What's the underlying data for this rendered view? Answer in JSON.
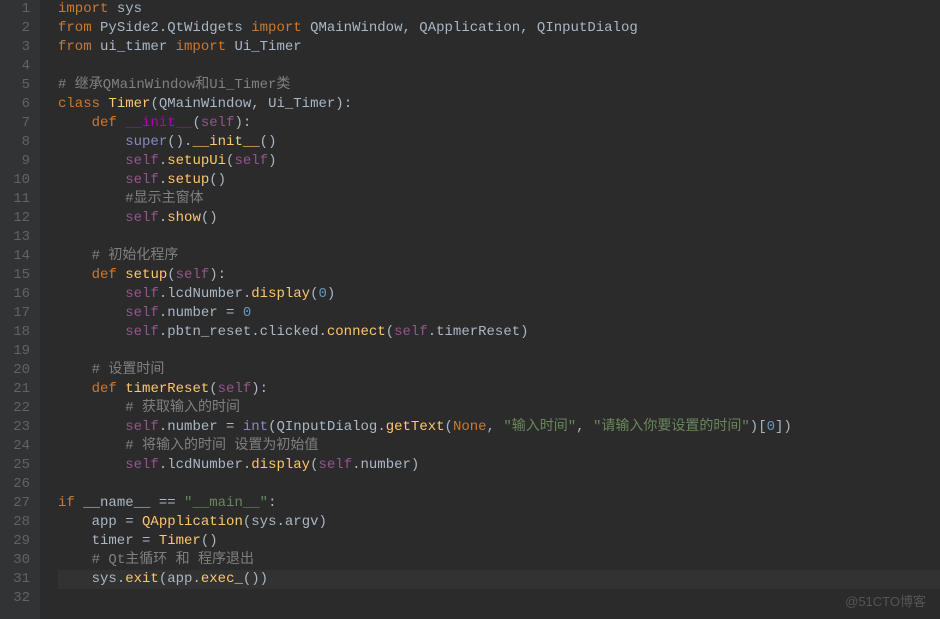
{
  "watermark": "@51CTO博客",
  "lines": [
    {
      "n": 1,
      "tokens": [
        [
          "keyword",
          "import"
        ],
        [
          "ident",
          " sys"
        ]
      ]
    },
    {
      "n": 2,
      "tokens": [
        [
          "keyword",
          "from"
        ],
        [
          "ident",
          " PySide2.QtWidgets "
        ],
        [
          "keyword",
          "import"
        ],
        [
          "ident",
          " QMainWindow"
        ],
        [
          "op",
          ","
        ],
        [
          "ident",
          " QApplication"
        ],
        [
          "op",
          ","
        ],
        [
          "ident",
          " QInputDialog"
        ]
      ]
    },
    {
      "n": 3,
      "tokens": [
        [
          "keyword",
          "from"
        ],
        [
          "ident",
          " ui_timer "
        ],
        [
          "keyword",
          "import"
        ],
        [
          "ident",
          " Ui_Timer"
        ]
      ]
    },
    {
      "n": 4,
      "tokens": []
    },
    {
      "n": 5,
      "tokens": [
        [
          "comment",
          "# 继承QMainWindow和Ui_Timer类"
        ]
      ]
    },
    {
      "n": 6,
      "tokens": [
        [
          "keyword",
          "class"
        ],
        [
          "ident",
          " "
        ],
        [
          "defname",
          "Timer"
        ],
        [
          "paren",
          "("
        ],
        [
          "ident",
          "QMainWindow"
        ],
        [
          "op",
          ","
        ],
        [
          "ident",
          " Ui_Timer"
        ],
        [
          "paren",
          ")"
        ],
        [
          "op",
          ":"
        ]
      ]
    },
    {
      "n": 7,
      "tokens": [
        [
          "ident",
          "    "
        ],
        [
          "keyword",
          "def"
        ],
        [
          "ident",
          " "
        ],
        [
          "special",
          "__init__"
        ],
        [
          "paren",
          "("
        ],
        [
          "self",
          "self"
        ],
        [
          "paren",
          ")"
        ],
        [
          "op",
          ":"
        ]
      ]
    },
    {
      "n": 8,
      "tokens": [
        [
          "ident",
          "        "
        ],
        [
          "builtin",
          "super"
        ],
        [
          "paren",
          "()"
        ],
        [
          "op",
          "."
        ],
        [
          "func",
          "__init__"
        ],
        [
          "paren",
          "()"
        ]
      ]
    },
    {
      "n": 9,
      "tokens": [
        [
          "ident",
          "        "
        ],
        [
          "self",
          "self"
        ],
        [
          "op",
          "."
        ],
        [
          "func",
          "setupUi"
        ],
        [
          "paren",
          "("
        ],
        [
          "self",
          "self"
        ],
        [
          "paren",
          ")"
        ]
      ]
    },
    {
      "n": 10,
      "tokens": [
        [
          "ident",
          "        "
        ],
        [
          "self",
          "self"
        ],
        [
          "op",
          "."
        ],
        [
          "func",
          "setup"
        ],
        [
          "paren",
          "()"
        ]
      ]
    },
    {
      "n": 11,
      "tokens": [
        [
          "ident",
          "        "
        ],
        [
          "comment",
          "#显示主窗体"
        ]
      ]
    },
    {
      "n": 12,
      "tokens": [
        [
          "ident",
          "        "
        ],
        [
          "self",
          "self"
        ],
        [
          "op",
          "."
        ],
        [
          "func",
          "show"
        ],
        [
          "paren",
          "()"
        ]
      ]
    },
    {
      "n": 13,
      "tokens": []
    },
    {
      "n": 14,
      "tokens": [
        [
          "ident",
          "    "
        ],
        [
          "comment",
          "# 初始化程序"
        ]
      ]
    },
    {
      "n": 15,
      "tokens": [
        [
          "ident",
          "    "
        ],
        [
          "keyword",
          "def"
        ],
        [
          "ident",
          " "
        ],
        [
          "defname",
          "setup"
        ],
        [
          "paren",
          "("
        ],
        [
          "self",
          "self"
        ],
        [
          "paren",
          ")"
        ],
        [
          "op",
          ":"
        ]
      ]
    },
    {
      "n": 16,
      "tokens": [
        [
          "ident",
          "        "
        ],
        [
          "self",
          "self"
        ],
        [
          "op",
          "."
        ],
        [
          "ident",
          "lcdNumber"
        ],
        [
          "op",
          "."
        ],
        [
          "func",
          "display"
        ],
        [
          "paren",
          "("
        ],
        [
          "number",
          "0"
        ],
        [
          "paren",
          ")"
        ]
      ]
    },
    {
      "n": 17,
      "tokens": [
        [
          "ident",
          "        "
        ],
        [
          "self",
          "self"
        ],
        [
          "op",
          "."
        ],
        [
          "ident",
          "number "
        ],
        [
          "op",
          "="
        ],
        [
          "ident",
          " "
        ],
        [
          "number",
          "0"
        ]
      ]
    },
    {
      "n": 18,
      "tokens": [
        [
          "ident",
          "        "
        ],
        [
          "self",
          "self"
        ],
        [
          "op",
          "."
        ],
        [
          "ident",
          "pbtn_reset"
        ],
        [
          "op",
          "."
        ],
        [
          "ident",
          "clicked"
        ],
        [
          "op",
          "."
        ],
        [
          "func",
          "connect"
        ],
        [
          "paren",
          "("
        ],
        [
          "self",
          "self"
        ],
        [
          "op",
          "."
        ],
        [
          "ident",
          "timerReset"
        ],
        [
          "paren",
          ")"
        ]
      ]
    },
    {
      "n": 19,
      "tokens": []
    },
    {
      "n": 20,
      "tokens": [
        [
          "ident",
          "    "
        ],
        [
          "comment",
          "# 设置时间"
        ]
      ]
    },
    {
      "n": 21,
      "tokens": [
        [
          "ident",
          "    "
        ],
        [
          "keyword",
          "def"
        ],
        [
          "ident",
          " "
        ],
        [
          "defname",
          "timerReset"
        ],
        [
          "paren",
          "("
        ],
        [
          "self",
          "self"
        ],
        [
          "paren",
          ")"
        ],
        [
          "op",
          ":"
        ]
      ]
    },
    {
      "n": 22,
      "tokens": [
        [
          "ident",
          "        "
        ],
        [
          "comment",
          "# 获取输入的时间"
        ]
      ]
    },
    {
      "n": 23,
      "tokens": [
        [
          "ident",
          "        "
        ],
        [
          "self",
          "self"
        ],
        [
          "op",
          "."
        ],
        [
          "ident",
          "number "
        ],
        [
          "op",
          "="
        ],
        [
          "ident",
          " "
        ],
        [
          "builtin",
          "int"
        ],
        [
          "paren",
          "("
        ],
        [
          "ident",
          "QInputDialog"
        ],
        [
          "op",
          "."
        ],
        [
          "func",
          "getText"
        ],
        [
          "paren",
          "("
        ],
        [
          "keyword",
          "None"
        ],
        [
          "op",
          ","
        ],
        [
          "ident",
          " "
        ],
        [
          "string",
          "\"输入时间\""
        ],
        [
          "op",
          ","
        ],
        [
          "ident",
          " "
        ],
        [
          "string",
          "\"请输入你要设置的时间\""
        ],
        [
          "paren",
          ")["
        ],
        [
          "number",
          "0"
        ],
        [
          "paren",
          "])"
        ]
      ]
    },
    {
      "n": 24,
      "tokens": [
        [
          "ident",
          "        "
        ],
        [
          "comment",
          "# 将输入的时间 设置为初始值"
        ]
      ]
    },
    {
      "n": 25,
      "tokens": [
        [
          "ident",
          "        "
        ],
        [
          "self",
          "self"
        ],
        [
          "op",
          "."
        ],
        [
          "ident",
          "lcdNumber"
        ],
        [
          "op",
          "."
        ],
        [
          "func",
          "display"
        ],
        [
          "paren",
          "("
        ],
        [
          "self",
          "self"
        ],
        [
          "op",
          "."
        ],
        [
          "ident",
          "number"
        ],
        [
          "paren",
          ")"
        ]
      ]
    },
    {
      "n": 26,
      "tokens": []
    },
    {
      "n": 27,
      "tokens": [
        [
          "keyword",
          "if"
        ],
        [
          "ident",
          " __name__ "
        ],
        [
          "op",
          "=="
        ],
        [
          "ident",
          " "
        ],
        [
          "string",
          "\"__main__\""
        ],
        [
          "op",
          ":"
        ]
      ]
    },
    {
      "n": 28,
      "tokens": [
        [
          "ident",
          "    app "
        ],
        [
          "op",
          "="
        ],
        [
          "ident",
          " "
        ],
        [
          "func",
          "QApplication"
        ],
        [
          "paren",
          "("
        ],
        [
          "ident",
          "sys"
        ],
        [
          "op",
          "."
        ],
        [
          "ident",
          "argv"
        ],
        [
          "paren",
          ")"
        ]
      ]
    },
    {
      "n": 29,
      "tokens": [
        [
          "ident",
          "    timer "
        ],
        [
          "op",
          "="
        ],
        [
          "ident",
          " "
        ],
        [
          "func",
          "Timer"
        ],
        [
          "paren",
          "()"
        ]
      ]
    },
    {
      "n": 30,
      "tokens": [
        [
          "ident",
          "    "
        ],
        [
          "comment",
          "# Qt主循环 和 程序退出"
        ]
      ]
    },
    {
      "n": 31,
      "current": true,
      "tokens": [
        [
          "ident",
          "    sys"
        ],
        [
          "op",
          "."
        ],
        [
          "func",
          "exit"
        ],
        [
          "paren",
          "("
        ],
        [
          "ident",
          "app"
        ],
        [
          "op",
          "."
        ],
        [
          "func",
          "exec_"
        ],
        [
          "paren",
          "())"
        ]
      ]
    },
    {
      "n": 32,
      "tokens": []
    }
  ]
}
